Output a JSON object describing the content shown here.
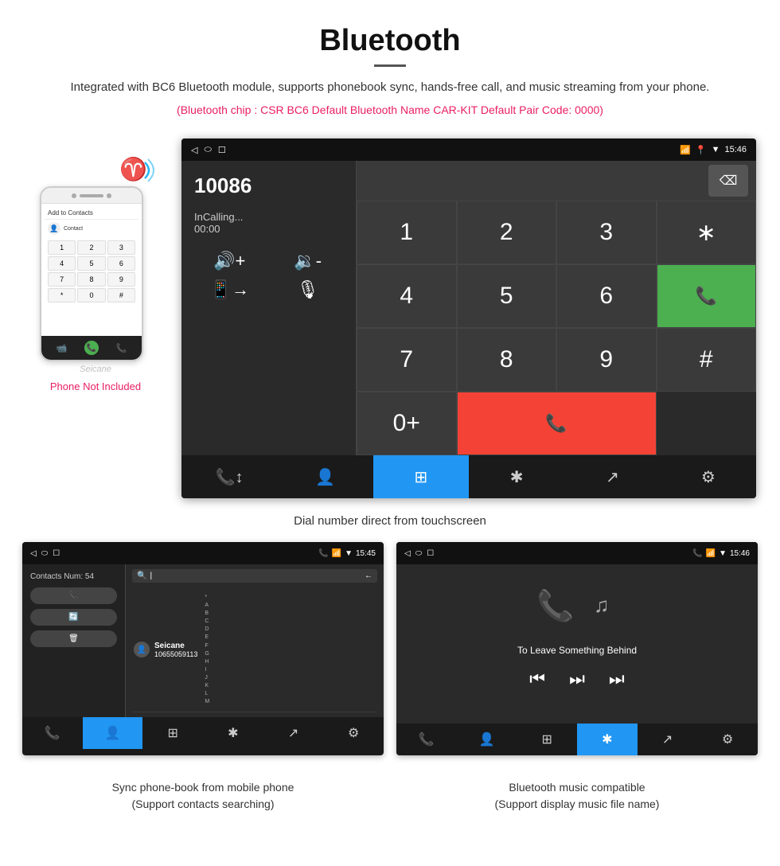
{
  "header": {
    "title": "Bluetooth",
    "description": "Integrated with BC6 Bluetooth module, supports phonebook sync, hands-free call, and music streaming from your phone.",
    "specs": "(Bluetooth chip : CSR BC6    Default Bluetooth Name CAR-KIT    Default Pair Code: 0000)"
  },
  "phone_side": {
    "not_included": "Phone Not Included",
    "contact_add": "Add to Contacts"
  },
  "car_screen": {
    "status_time": "15:46",
    "phone_number": "10086",
    "calling_status": "InCalling...",
    "call_timer": "00:00",
    "dialpad": [
      "1",
      "2",
      "3",
      "*",
      "4",
      "5",
      "6",
      "0+",
      "7",
      "8",
      "9",
      "#"
    ],
    "call_btn": "📞",
    "hangup_btn": "📞"
  },
  "main_caption": "Dial number direct from touchscreen",
  "contacts_screen": {
    "status_time": "15:45",
    "contacts_num": "Contacts Num: 54",
    "contact_name": "Seicane",
    "contact_phone": "10655059113",
    "alphabet": [
      "A",
      "B",
      "C",
      "D",
      "E",
      "F",
      "G",
      "H",
      "I",
      "J",
      "K",
      "L",
      "M"
    ]
  },
  "music_screen": {
    "status_time": "15:46",
    "song_title": "To Leave Something Behind"
  },
  "bottom_captions": {
    "left": "Sync phone-book from mobile phone\n(Support contacts searching)",
    "right": "Bluetooth music compatible\n(Support display music file name)"
  }
}
